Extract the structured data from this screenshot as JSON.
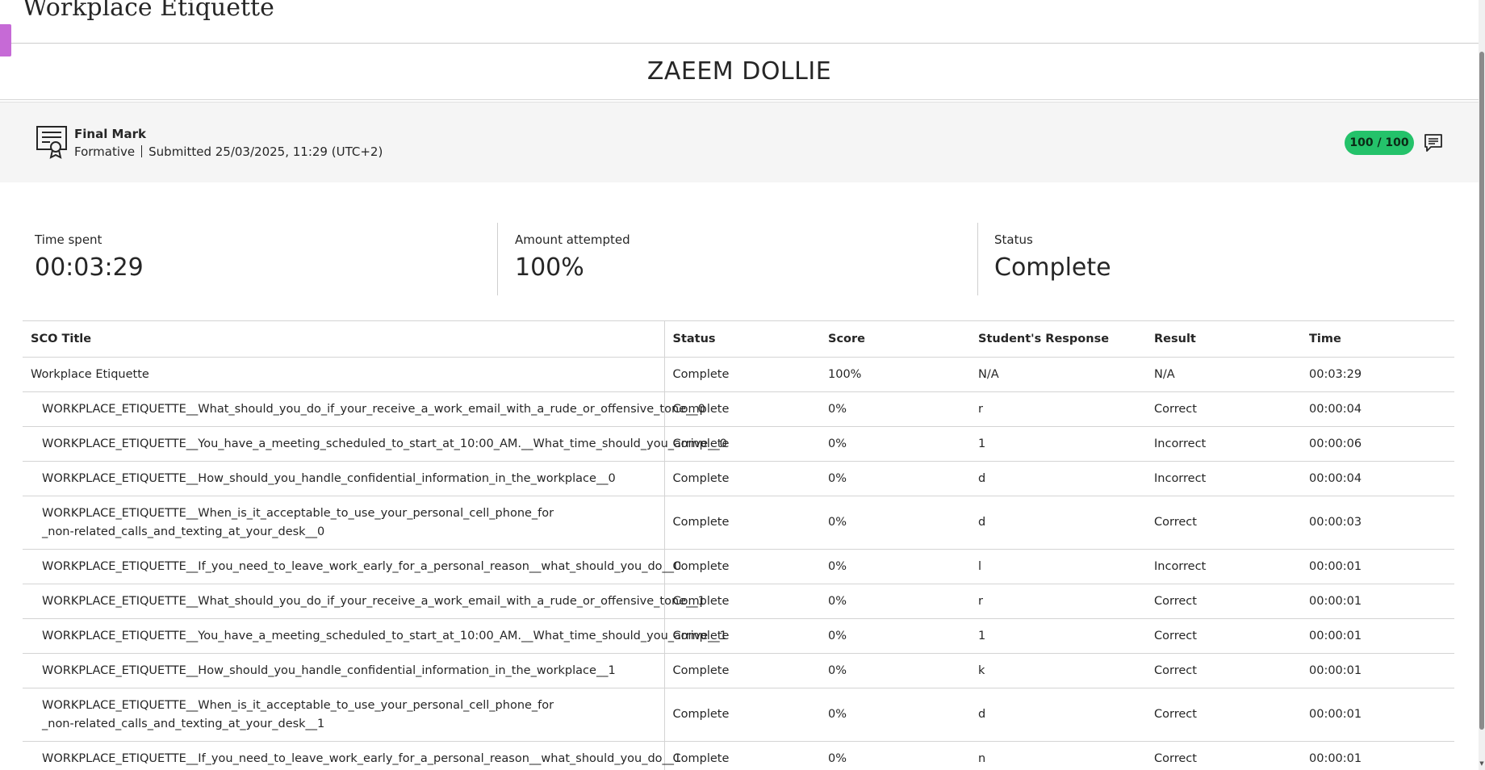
{
  "page": {
    "title": "Workplace Etiquette",
    "student_name": "ZAEEM DOLLIE"
  },
  "final_mark": {
    "title": "Final Mark",
    "type": "Formative",
    "submitted": "Submitted 25/03/2025, 11:29 (UTC+2)",
    "grade": "100 / 100",
    "grade_color": "#24c26a",
    "icon": "certificate-icon",
    "feedback_icon": "feedback-icon"
  },
  "stats": {
    "time_spent_label": "Time spent",
    "time_spent_value": "00:03:29",
    "amount_label": "Amount attempted",
    "amount_value": "100%",
    "status_label": "Status",
    "status_value": "Complete"
  },
  "table": {
    "headers": [
      "SCO Title",
      "Status",
      "Score",
      "Student's Response",
      "Result",
      "Time"
    ],
    "rows": [
      [
        "Workplace Etiquette",
        "Complete",
        "100%",
        "N/A",
        "N/A",
        "00:03:29"
      ],
      [
        "WORKPLACE_ETIQUETTE__What_should_you_do_if_your_receive_a_work_email_with_a_rude_or_offensive_tone__0",
        "Complete",
        "0%",
        "r",
        "Correct",
        "00:00:04"
      ],
      [
        "WORKPLACE_ETIQUETTE__You_have_a_meeting_scheduled_to_start_at_10:00_AM.__What_time_should_you_arrive__0",
        "Complete",
        "0%",
        "1",
        "Incorrect",
        "00:00:06"
      ],
      [
        "WORKPLACE_ETIQUETTE__How_should_you_handle_confidential_information_in_the_workplace__0",
        "Complete",
        "0%",
        "d",
        "Incorrect",
        "00:00:04"
      ],
      [
        "WORKPLACE_ETIQUETTE__When_is_it_acceptable_to_use_your_personal_cell_phone_for_non-related_calls_and_texting_at_your_desk__0",
        "Complete",
        "0%",
        "d",
        "Correct",
        "00:00:03"
      ],
      [
        "WORKPLACE_ETIQUETTE__If_you_need_to_leave_work_early_for_a_personal_reason__what_should_you_do__0",
        "Complete",
        "0%",
        "l",
        "Incorrect",
        "00:00:01"
      ],
      [
        "WORKPLACE_ETIQUETTE__What_should_you_do_if_your_receive_a_work_email_with_a_rude_or_offensive_tone__1",
        "Complete",
        "0%",
        "r",
        "Correct",
        "00:00:01"
      ],
      [
        "WORKPLACE_ETIQUETTE__You_have_a_meeting_scheduled_to_start_at_10:00_AM.__What_time_should_you_arrive__1",
        "Complete",
        "0%",
        "1",
        "Correct",
        "00:00:01"
      ],
      [
        "WORKPLACE_ETIQUETTE__How_should_you_handle_confidential_information_in_the_workplace__1",
        "Complete",
        "0%",
        "k",
        "Correct",
        "00:00:01"
      ],
      [
        "WORKPLACE_ETIQUETTE__When_is_it_acceptable_to_use_your_personal_cell_phone_for_non-related_calls_and_texting_at_your_desk__1",
        "Complete",
        "0%",
        "d",
        "Correct",
        "00:00:01"
      ],
      [
        "WORKPLACE_ETIQUETTE__If_you_need_to_leave_work_early_for_a_personal_reason__what_should_you_do__1",
        "Complete",
        "0%",
        "n",
        "Correct",
        "00:00:01"
      ]
    ]
  }
}
